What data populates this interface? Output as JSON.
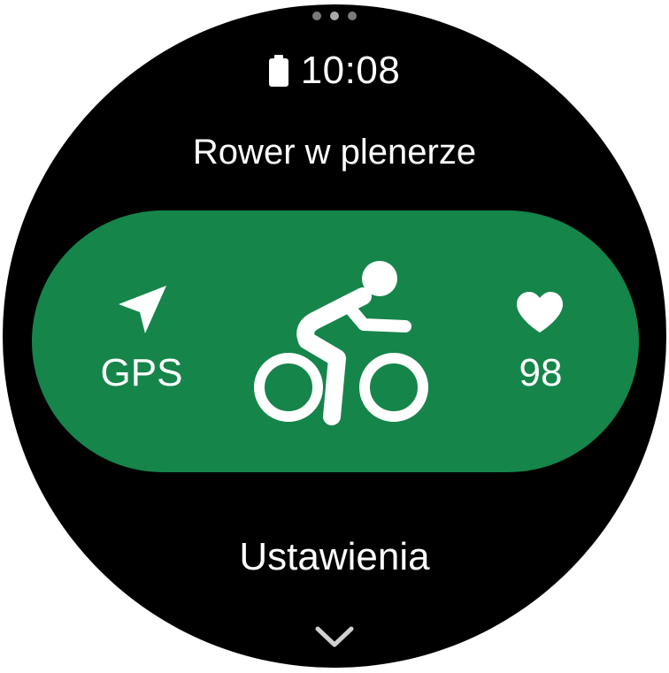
{
  "status": {
    "time": "10:08",
    "battery_icon": "battery-icon"
  },
  "pagination": {
    "dots": 3,
    "active_index": 1
  },
  "workout": {
    "title": "Rower w plenerze",
    "activity_icon": "cycling-icon",
    "gps": {
      "icon": "location-arrow-icon",
      "label": "GPS"
    },
    "heart_rate": {
      "icon": "heart-icon",
      "value": "98"
    }
  },
  "menu": {
    "settings_label": "Ustawienia",
    "more_icon": "chevron-down-icon"
  },
  "colors": {
    "background": "#000000",
    "accent": "#15854a",
    "text": "#ffffff",
    "dot_inactive": "#7a7a7a",
    "dot_active": "#a9a9a9"
  }
}
